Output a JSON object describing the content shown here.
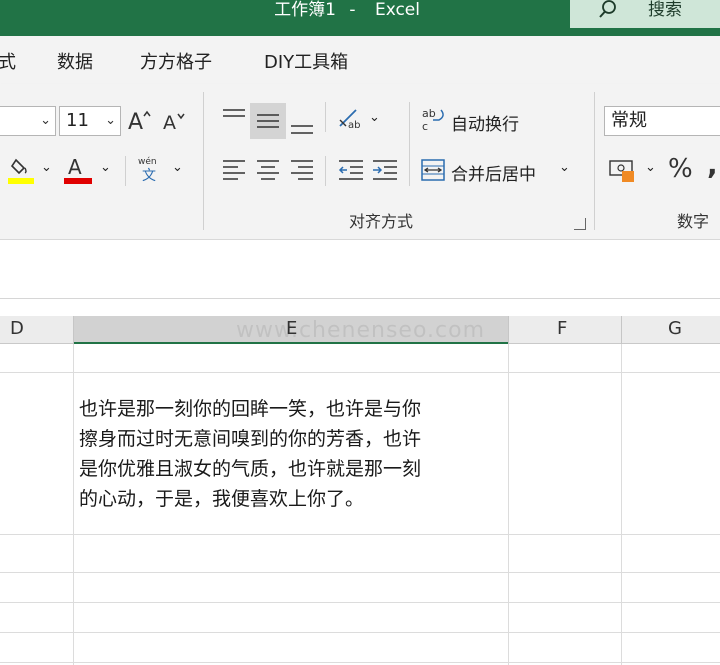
{
  "window": {
    "title": "工作簿1",
    "separator": "-",
    "app_name": "Excel",
    "search_label": "搜索"
  },
  "tabs": [
    {
      "label": "式"
    },
    {
      "label": "数据"
    },
    {
      "label": "方方格子"
    },
    {
      "label": "DIY工具箱"
    }
  ],
  "font_group": {
    "font_size": "11",
    "fill_color": "#ffff00",
    "font_color": "#e00000"
  },
  "alignment": {
    "wrap_text": "自动换行",
    "merge_center": "合并后居中",
    "group_label": "对齐方式"
  },
  "number": {
    "format": "常规",
    "percent": "%",
    "group_label": "数字"
  },
  "sheet": {
    "columns": [
      "D",
      "E",
      "F",
      "G"
    ],
    "selected_column": "E",
    "cell_lines": [
      "也许是那一刻你的回眸一笑，也许是与你",
      "擦身而过时无意间嗅到的你的芳香，也许",
      "是你优雅且淑女的气质，也许就是那一刻",
      "的心动，于是，我便喜欢上你了。"
    ],
    "watermark": "www.chenenseo.com"
  },
  "colors": {
    "excel_green": "#217346",
    "search_bg": "#cfe6d8"
  }
}
